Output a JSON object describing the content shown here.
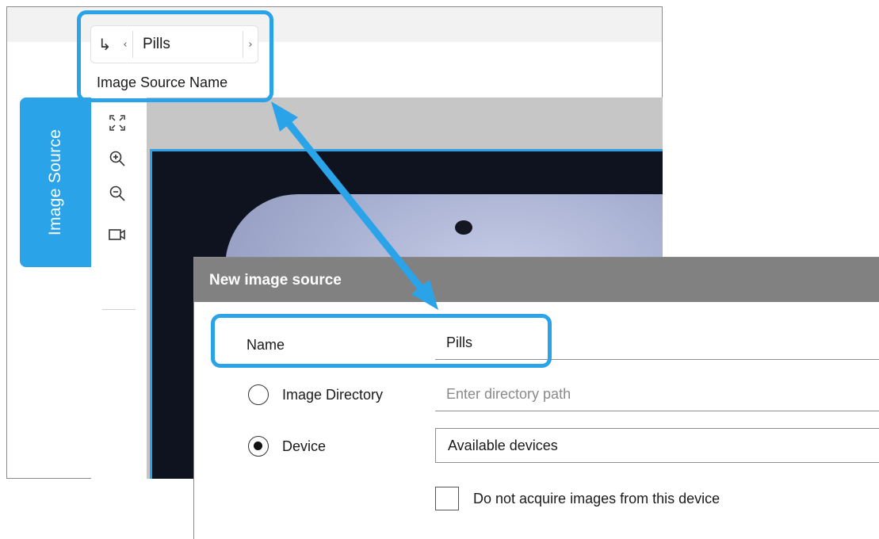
{
  "app": {
    "source_selector": {
      "value": "Pills",
      "caption": "Image Source Name",
      "return_icon": "return-arrow-icon",
      "prev_icon": "chevron-left-icon",
      "next_icon": "chevron-right-icon"
    },
    "side_tab": {
      "label": "Image Source"
    },
    "toolbar": {
      "items": [
        {
          "icon": "fit-to-window-icon"
        },
        {
          "icon": "zoom-in-icon"
        },
        {
          "icon": "zoom-out-icon"
        },
        {
          "icon": "video-camera-icon"
        }
      ]
    }
  },
  "dialog": {
    "title": "New image source",
    "name": {
      "label": "Name",
      "value": "Pills"
    },
    "image_directory": {
      "label": "Image Directory",
      "placeholder": "Enter directory path",
      "selected": false
    },
    "device": {
      "label": "Device",
      "selected": true,
      "dropdown_value": "Available devices"
    },
    "no_acquire": {
      "label": "Do not acquire images from this device",
      "checked": false
    }
  },
  "colors": {
    "accent": "#2aa3e8",
    "dialog_titlebar": "#818181",
    "viewer_background": "#c6c6c6"
  }
}
